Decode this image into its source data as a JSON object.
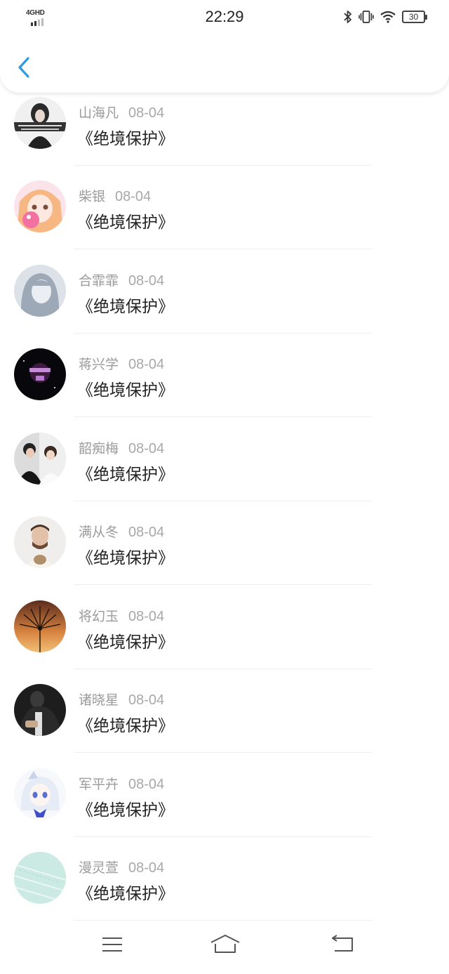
{
  "status_bar": {
    "network": "4GHD",
    "time": "22:29",
    "battery": "30",
    "icons": [
      "bluetooth-icon",
      "vibrate-icon",
      "wifi-icon",
      "battery-icon"
    ]
  },
  "header": {
    "back_icon": "chevron-left-icon",
    "accent_color": "#2d9be0"
  },
  "comments": [
    {
      "user": "山海凡",
      "date": "08-04",
      "text": "《绝境保护》"
    },
    {
      "user": "柴银",
      "date": "08-04",
      "text": "《绝境保护》"
    },
    {
      "user": "合霏霏",
      "date": "08-04",
      "text": "《绝境保护》"
    },
    {
      "user": "蒋兴学",
      "date": "08-04",
      "text": "《绝境保护》"
    },
    {
      "user": "韶痴梅",
      "date": "08-04",
      "text": "《绝境保护》"
    },
    {
      "user": "满从冬",
      "date": "08-04",
      "text": "《绝境保护》"
    },
    {
      "user": "将幻玉",
      "date": "08-04",
      "text": "《绝境保护》"
    },
    {
      "user": "诸晓星",
      "date": "08-04",
      "text": "《绝境保护》"
    },
    {
      "user": "军平卉",
      "date": "08-04",
      "text": "《绝境保护》"
    },
    {
      "user": "漫灵萱",
      "date": "08-04",
      "text": "《绝境保护》"
    }
  ],
  "bottom_nav": {
    "icons": [
      "menu-icon",
      "home-icon",
      "back-icon"
    ]
  }
}
